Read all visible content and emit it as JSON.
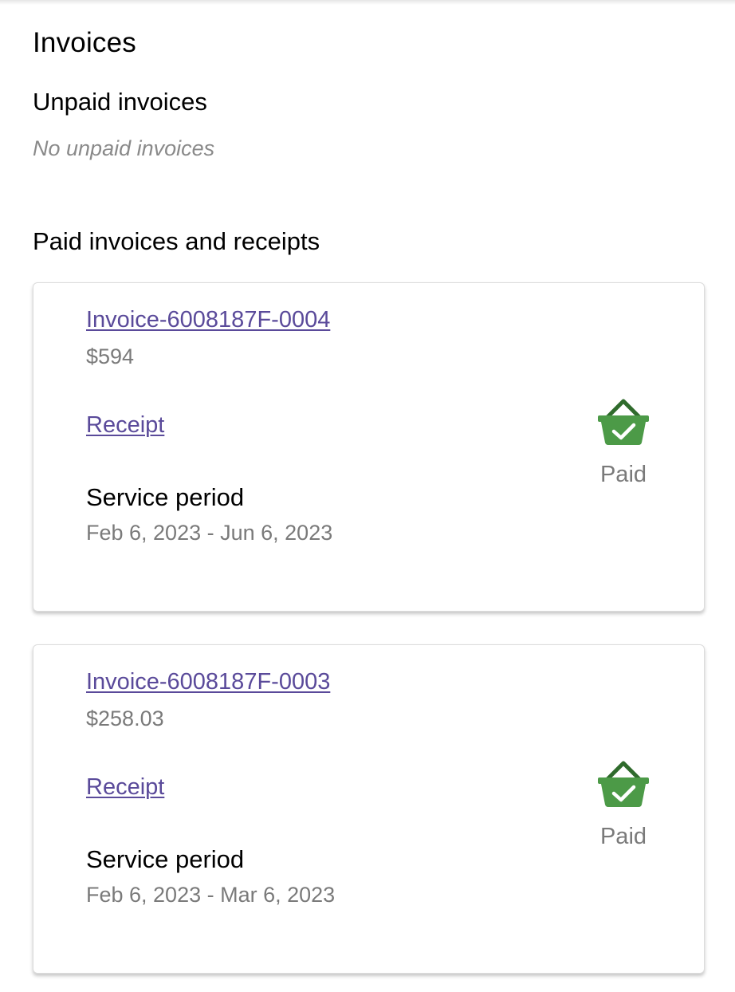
{
  "page": {
    "title": "Invoices"
  },
  "unpaid": {
    "heading": "Unpaid invoices",
    "empty_text": "No unpaid invoices"
  },
  "paid": {
    "heading": "Paid invoices and receipts",
    "invoices": [
      {
        "invoice_label": "Invoice-6008187F-0004",
        "amount": "$594",
        "receipt_label": "Receipt",
        "service_period_label": "Service period",
        "service_period": "Feb 6, 2023 - Jun 6, 2023",
        "status": "Paid",
        "status_icon": "paid-basket-check-icon"
      },
      {
        "invoice_label": "Invoice-6008187F-0003",
        "amount": "$258.03",
        "receipt_label": "Receipt",
        "service_period_label": "Service period",
        "service_period": "Feb 6, 2023 - Mar 6, 2023",
        "status": "Paid",
        "status_icon": "paid-basket-check-icon"
      }
    ]
  },
  "colors": {
    "link": "#5a4a9a",
    "secondary_text": "#7a7a7a",
    "paid_icon_green": "#4c9a47"
  }
}
